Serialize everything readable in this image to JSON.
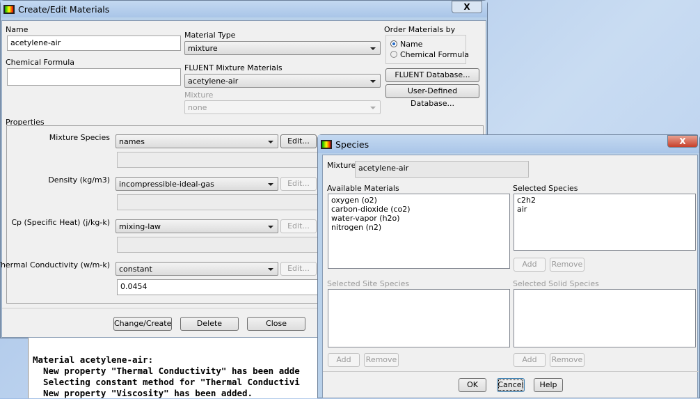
{
  "main": {
    "title": "Create/Edit Materials",
    "name_label": "Name",
    "name_value": "acetylene-air",
    "formula_label": "Chemical Formula",
    "formula_value": "",
    "material_type_label": "Material Type",
    "material_type_value": "mixture",
    "fluent_mixture_label": "FLUENT Mixture Materials",
    "fluent_mixture_value": "acetylene-air",
    "mixture_label": "Mixture",
    "mixture_value": "none",
    "order_label": "Order Materials by",
    "order_options": [
      "Name",
      "Chemical Formula"
    ],
    "order_selected": "Name",
    "fluent_db": "FLUENT Database...",
    "user_db": "User-Defined Database...",
    "properties_label": "Properties",
    "properties": [
      {
        "label": "Mixture Species",
        "method": "names",
        "edit": "Edit...",
        "value": ""
      },
      {
        "label": "Density (kg/m3)",
        "method": "incompressible-ideal-gas",
        "edit": "Edit...",
        "value": ""
      },
      {
        "label": "Cp (Specific Heat) (j/kg-k)",
        "method": "mixing-law",
        "edit": "Edit...",
        "value": ""
      },
      {
        "label": "Thermal Conductivity (w/m-k)",
        "method": "constant",
        "edit": "Edit...",
        "value": "0.0454"
      }
    ],
    "buttons": [
      "Change/Create",
      "Delete",
      "Close"
    ]
  },
  "console": [
    "Material acetylene-air:",
    "  New property \"Thermal Conductivity\" has been adde",
    "  Selecting constant method for \"Thermal Conductivi",
    "  New property \"Viscosity\" has been added."
  ],
  "species": {
    "title": "Species",
    "mixture_label": "Mixture",
    "mixture_value": "acetylene-air",
    "available_label": "Available Materials",
    "available": [
      "oxygen (o2)",
      "carbon-dioxide (co2)",
      "water-vapor (h2o)",
      "nitrogen (n2)"
    ],
    "selected_label": "Selected Species",
    "selected": [
      "c2h2",
      "air"
    ],
    "site_label": "Selected Site Species",
    "solid_label": "Selected Solid Species",
    "add": "Add",
    "remove": "Remove",
    "ok": "OK",
    "cancel": "Cancel",
    "help": "Help"
  },
  "close_glyph": "X"
}
